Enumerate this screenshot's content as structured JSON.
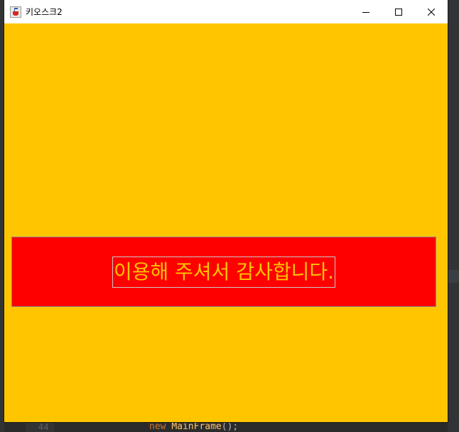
{
  "window": {
    "title": "키오스크2",
    "controls": {
      "minimize_icon": "minimize-icon",
      "maximize_icon": "maximize-icon",
      "close_icon": "close-icon"
    }
  },
  "content": {
    "background_color": "#ffc600",
    "banner": {
      "text": "이용해 주셔서 감사합니다.",
      "background_color": "#ff0000",
      "text_color": "#ffc600"
    }
  },
  "ide_background": {
    "line_number": "44",
    "code_keyword": "new",
    "code_call": "MainFrame",
    "code_suffix": "();"
  }
}
